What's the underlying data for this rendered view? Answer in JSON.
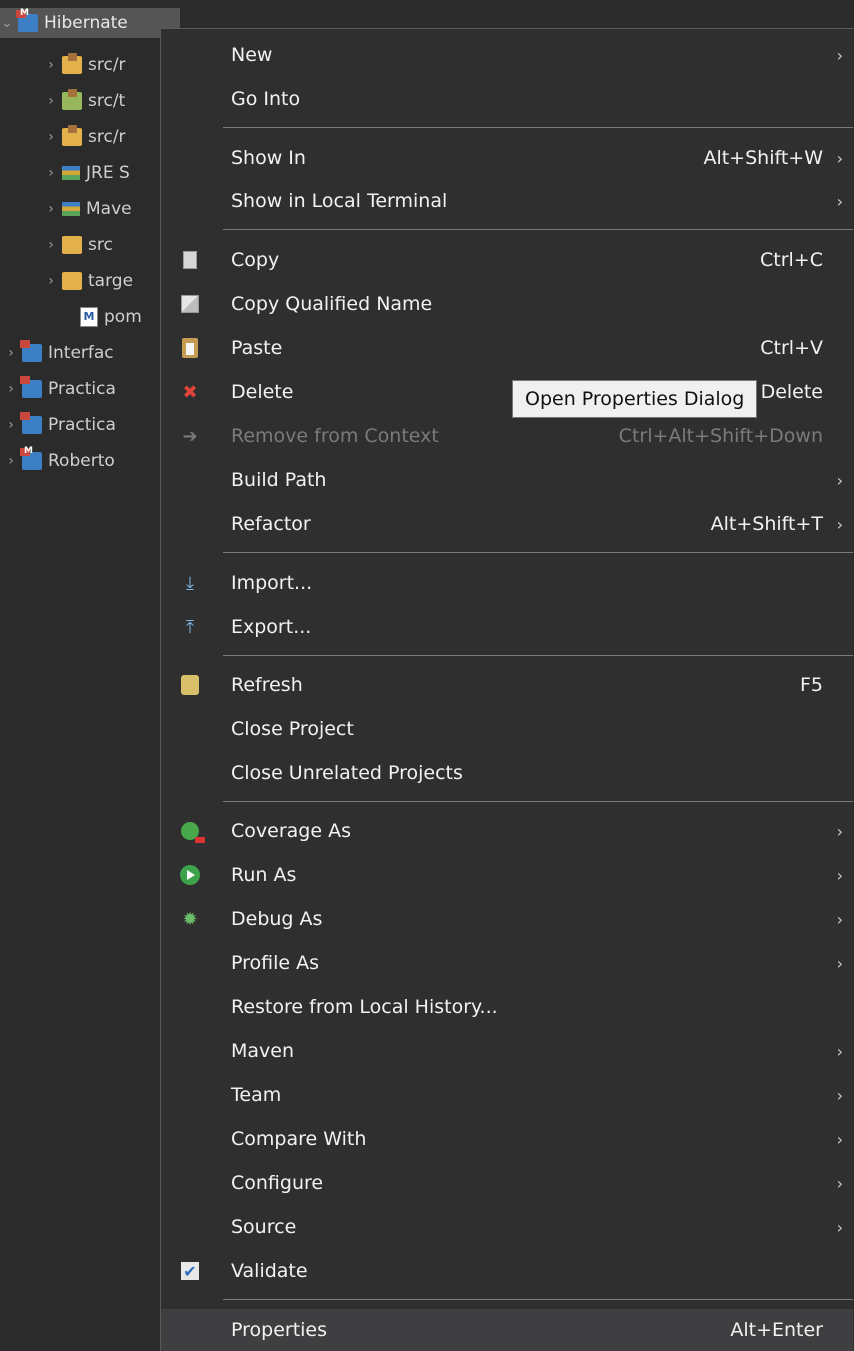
{
  "tree": [
    {
      "label": "Hibernate",
      "icon": "maven-project-icon",
      "chevron": "⌄"
    },
    {
      "label": "src/r",
      "icon": "package-folder-icon",
      "chevron": "›"
    },
    {
      "label": "src/t",
      "icon": "test-package-folder-icon",
      "chevron": "›"
    },
    {
      "label": "src/r",
      "icon": "package-folder-icon",
      "chevron": "›"
    },
    {
      "label": "JRE S",
      "icon": "library-icon",
      "chevron": "›"
    },
    {
      "label": "Mave",
      "icon": "library-icon",
      "chevron": "›"
    },
    {
      "label": "src",
      "icon": "folder-icon",
      "chevron": "›"
    },
    {
      "label": "targe",
      "icon": "folder-icon",
      "chevron": "›"
    },
    {
      "label": "pom",
      "icon": "maven-file-icon",
      "chevron": ""
    },
    {
      "label": "Interfac",
      "icon": "project-icon",
      "chevron": "›"
    },
    {
      "label": "Practica",
      "icon": "project-icon",
      "chevron": "›"
    },
    {
      "label": "Practica",
      "icon": "project-icon",
      "chevron": "›"
    },
    {
      "label": "Roberto",
      "icon": "maven-project-icon",
      "chevron": "›"
    }
  ],
  "menu": {
    "new": {
      "label": "New",
      "arrow": "›"
    },
    "go_into": {
      "label": "Go Into"
    },
    "show_in": {
      "label": "Show In",
      "shortcut": "Alt+Shift+W",
      "arrow": "›"
    },
    "show_terminal": {
      "label": "Show in Local Terminal",
      "arrow": "›"
    },
    "copy": {
      "label": "Copy",
      "shortcut": "Ctrl+C",
      "icon": "copy-icon"
    },
    "copy_qualified": {
      "label": "Copy Qualified Name",
      "icon": "copy-qualified-name-icon"
    },
    "paste": {
      "label": "Paste",
      "shortcut": "Ctrl+V",
      "icon": "paste-icon"
    },
    "delete": {
      "label": "Delete",
      "shortcut": "Delete",
      "icon": "delete-icon"
    },
    "remove_context": {
      "label": "Remove from Context",
      "shortcut": "Ctrl+Alt+Shift+Down",
      "icon": "remove-from-context-icon"
    },
    "build_path": {
      "label": "Build Path",
      "arrow": "›"
    },
    "refactor": {
      "label": "Refactor",
      "shortcut": "Alt+Shift+T",
      "arrow": "›"
    },
    "import": {
      "label": "Import...",
      "icon": "import-icon"
    },
    "export": {
      "label": "Export...",
      "icon": "export-icon"
    },
    "refresh": {
      "label": "Refresh",
      "shortcut": "F5",
      "icon": "refresh-icon"
    },
    "close_project": {
      "label": "Close Project"
    },
    "close_unrelated": {
      "label": "Close Unrelated Projects"
    },
    "coverage_as": {
      "label": "Coverage As",
      "arrow": "›",
      "icon": "coverage-icon"
    },
    "run_as": {
      "label": "Run As",
      "arrow": "›",
      "icon": "run-icon"
    },
    "debug_as": {
      "label": "Debug As",
      "arrow": "›",
      "icon": "debug-icon"
    },
    "profile_as": {
      "label": "Profile As",
      "arrow": "›"
    },
    "restore_history": {
      "label": "Restore from Local History..."
    },
    "maven": {
      "label": "Maven",
      "arrow": "›"
    },
    "team": {
      "label": "Team",
      "arrow": "›"
    },
    "compare_with": {
      "label": "Compare With",
      "arrow": "›"
    },
    "configure": {
      "label": "Configure",
      "arrow": "›"
    },
    "source": {
      "label": "Source",
      "arrow": "›"
    },
    "validate": {
      "label": "Validate",
      "icon": "checkbox-checked-icon"
    },
    "properties": {
      "label": "Properties",
      "shortcut": "Alt+Enter"
    }
  },
  "tooltip": {
    "text": "Open Properties Dialog"
  },
  "colors": {
    "background": "#2b2b2b",
    "menu_bg": "#2f2f30",
    "highlight": "#3f3f41",
    "tooltip_bg": "#f0f0f0"
  }
}
